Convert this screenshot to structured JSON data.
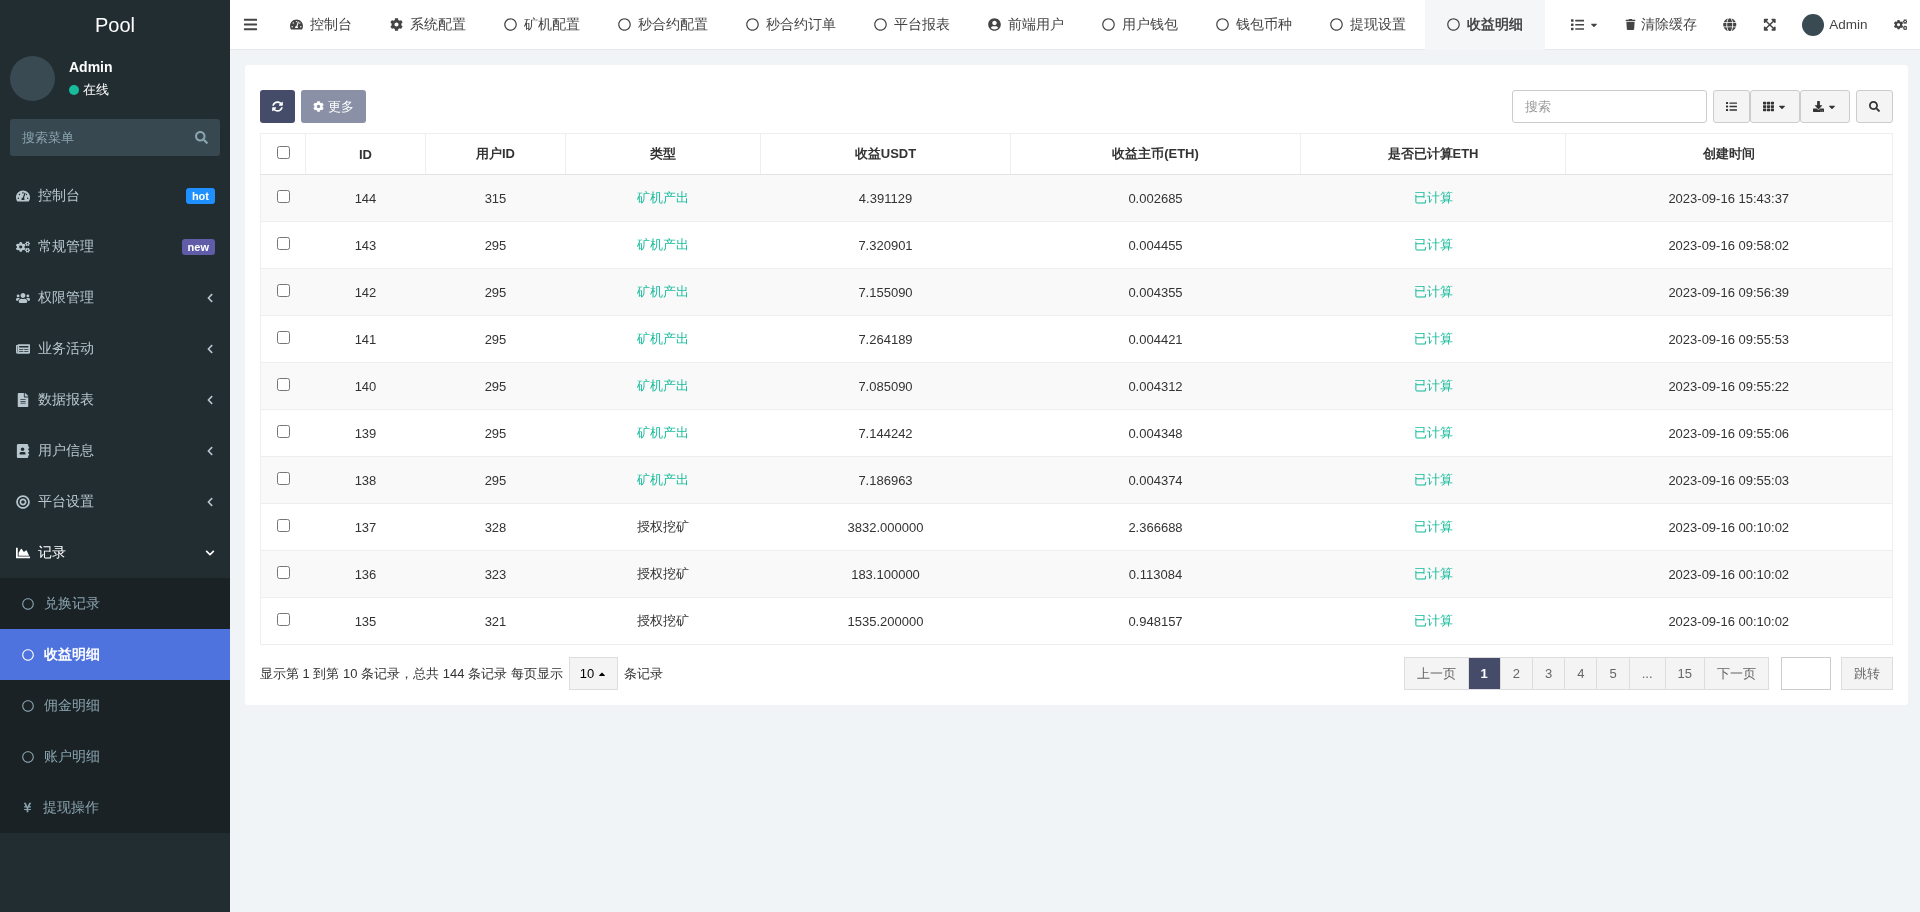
{
  "sidebar": {
    "logo": "Pool",
    "user": {
      "name": "Admin",
      "status": "在线",
      "online": true
    },
    "search": {
      "placeholder": "搜索菜单"
    },
    "items": [
      {
        "label": "控制台",
        "badge": "hot",
        "color": "#1e90ff"
      },
      {
        "label": "常规管理",
        "badge": "new",
        "color": "#605ca8"
      },
      {
        "label": "权限管理",
        "expanded": false
      },
      {
        "label": "业务活动",
        "expanded": false
      },
      {
        "label": "数据报表",
        "expanded": false
      },
      {
        "label": "用户信息",
        "expanded": false
      },
      {
        "label": "平台设置",
        "expanded": false
      },
      {
        "label": "记录",
        "expanded": true,
        "children": [
          {
            "label": "兑换记录",
            "selected": false,
            "kind": "circle"
          },
          {
            "label": "收益明细",
            "selected": true,
            "kind": "circle"
          },
          {
            "label": "佣金明细",
            "selected": false,
            "kind": "circle"
          },
          {
            "label": "账户明细",
            "selected": false,
            "kind": "circle"
          },
          {
            "label": "提现操作",
            "selected": false,
            "kind": "yen"
          }
        ]
      }
    ]
  },
  "topbar": {
    "tabs": [
      {
        "label": "控制台",
        "selected": false
      },
      {
        "label": "系统配置",
        "selected": false
      },
      {
        "label": "矿机配置",
        "selected": false
      },
      {
        "label": "秒合约配置",
        "selected": false
      },
      {
        "label": "秒合约订单",
        "selected": false
      },
      {
        "label": "平台报表",
        "selected": false
      },
      {
        "label": "前端用户",
        "selected": false
      },
      {
        "label": "用户钱包",
        "selected": false
      },
      {
        "label": "钱包币种",
        "selected": false
      },
      {
        "label": "提现设置",
        "selected": false
      },
      {
        "label": "收益明细",
        "selected": true
      }
    ],
    "clear_cache": "清除缓存",
    "user": "Admin"
  },
  "toolbar": {
    "more": "更多",
    "search": {
      "placeholder": "搜索"
    }
  },
  "table": {
    "select_all_checked": false,
    "columns": [
      "ID",
      "用户ID",
      "类型",
      "收益USDT",
      "收益主币(ETH)",
      "是否已计算ETH",
      "创建时间"
    ],
    "rows": [
      {
        "checked": false,
        "cells": [
          "144",
          "315",
          "矿机产出",
          "4.391129",
          "0.002685",
          "已计算",
          "2023-09-16 15:43:37"
        ],
        "color": "#18bc9c"
      },
      {
        "checked": false,
        "cells": [
          "143",
          "295",
          "矿机产出",
          "7.320901",
          "0.004455",
          "已计算",
          "2023-09-16 09:58:02"
        ],
        "color": "#18bc9c"
      },
      {
        "checked": false,
        "cells": [
          "142",
          "295",
          "矿机产出",
          "7.155090",
          "0.004355",
          "已计算",
          "2023-09-16 09:56:39"
        ],
        "color": "#18bc9c"
      },
      {
        "checked": false,
        "cells": [
          "141",
          "295",
          "矿机产出",
          "7.264189",
          "0.004421",
          "已计算",
          "2023-09-16 09:55:53"
        ],
        "color": "#18bc9c"
      },
      {
        "checked": false,
        "cells": [
          "140",
          "295",
          "矿机产出",
          "7.085090",
          "0.004312",
          "已计算",
          "2023-09-16 09:55:22"
        ],
        "color": "#18bc9c"
      },
      {
        "checked": false,
        "cells": [
          "139",
          "295",
          "矿机产出",
          "7.144242",
          "0.004348",
          "已计算",
          "2023-09-16 09:55:06"
        ],
        "color": "#18bc9c"
      },
      {
        "checked": false,
        "cells": [
          "138",
          "295",
          "矿机产出",
          "7.186963",
          "0.004374",
          "已计算",
          "2023-09-16 09:55:03"
        ],
        "color": "#18bc9c"
      },
      {
        "checked": false,
        "cells": [
          "137",
          "328",
          "授权挖矿",
          "3832.000000",
          "2.366688",
          "已计算",
          "2023-09-16 00:10:02"
        ],
        "color": "#333333"
      },
      {
        "checked": false,
        "cells": [
          "136",
          "323",
          "授权挖矿",
          "183.100000",
          "0.113084",
          "已计算",
          "2023-09-16 00:10:02"
        ],
        "color": "#333333"
      },
      {
        "checked": false,
        "cells": [
          "135",
          "321",
          "授权挖矿",
          "1535.200000",
          "0.948157",
          "已计算",
          "2023-09-16 00:10:02"
        ],
        "color": "#333333"
      }
    ]
  },
  "pagination": {
    "summary_before": "显示第 1 到第 10 条记录，总共 144 条记录 每页显示",
    "page_size": "10",
    "summary_after": "条记录",
    "prev": "上一页",
    "pages": [
      {
        "label": "1",
        "selected": true
      },
      {
        "label": "2",
        "selected": false
      },
      {
        "label": "3",
        "selected": false
      },
      {
        "label": "4",
        "selected": false
      },
      {
        "label": "5",
        "selected": false
      },
      {
        "label": "...",
        "selected": false
      },
      {
        "label": "15",
        "selected": false
      }
    ],
    "next": "下一页",
    "jump": "跳转"
  }
}
